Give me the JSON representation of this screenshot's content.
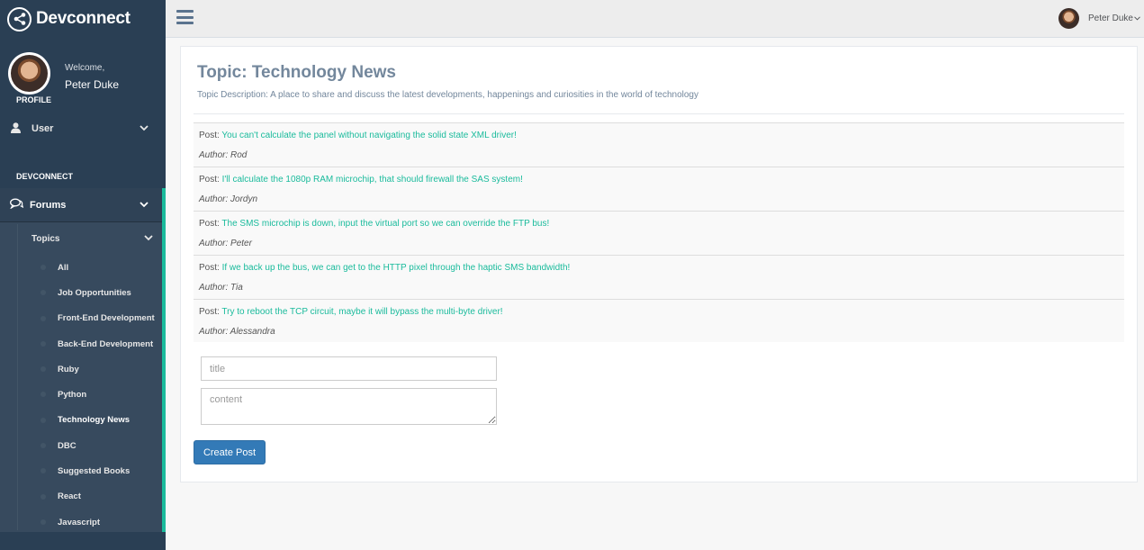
{
  "brand": {
    "name": "Devconnect",
    "logo_icon": "share-alt-icon"
  },
  "profile": {
    "welcome": "Welcome,",
    "name": "Peter Duke",
    "label": "PROFILE"
  },
  "sidebar": {
    "user_menu": {
      "label": "User",
      "icon": "user-icon"
    },
    "section_label": "DEVCONNECT",
    "forums": {
      "label": "Forums",
      "icon": "comments-icon",
      "topics_label": "Topics",
      "topics": [
        {
          "label": "All"
        },
        {
          "label": "Job Opportunities"
        },
        {
          "label": "Front-End Development"
        },
        {
          "label": "Back-End Development"
        },
        {
          "label": "Ruby"
        },
        {
          "label": "Python"
        },
        {
          "label": "Technology News",
          "active": true
        },
        {
          "label": "DBC"
        },
        {
          "label": "Suggested Books"
        },
        {
          "label": "React"
        },
        {
          "label": "Javascript"
        }
      ]
    }
  },
  "topbar": {
    "menu_icon": "hamburger-icon",
    "user_name": "Peter Duke"
  },
  "topic": {
    "title": "Topic: Technology News",
    "description": "Topic Description: A place to share and discuss the latest developments, happenings and curiosities in the world of technology"
  },
  "posts": [
    {
      "prefix": "Post:",
      "title": "You can't calculate the panel without navigating the solid state XML driver!",
      "author": "Author: Rod"
    },
    {
      "prefix": "Post:",
      "title": "I'll calculate the 1080p RAM microchip, that should firewall the SAS system!",
      "author": "Author: Jordyn"
    },
    {
      "prefix": "Post:",
      "title": "The SMS microchip is down, input the virtual port so we can override the FTP bus!",
      "author": "Author: Peter"
    },
    {
      "prefix": "Post:",
      "title": "If we back up the bus, we can get to the HTTP pixel through the haptic SMS bandwidth!",
      "author": "Author: Tia"
    },
    {
      "prefix": "Post:",
      "title": "Try to reboot the TCP circuit, maybe it will bypass the multi-byte driver!",
      "author": "Author: Alessandra"
    }
  ],
  "form": {
    "title_placeholder": "title",
    "content_placeholder": "content",
    "submit_label": "Create Post"
  },
  "colors": {
    "sidebar": "#2a3f54",
    "accent": "#1abb9c",
    "button": "#337ab7",
    "heading": "#73879c"
  }
}
